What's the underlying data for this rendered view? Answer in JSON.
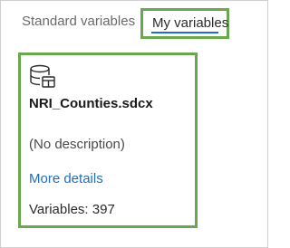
{
  "tabs": {
    "standard_label": "Standard variables",
    "my_label": "My variables"
  },
  "card": {
    "icon": "database-icon",
    "file_name": "NRI_Counties.sdcx",
    "description": "(No description)",
    "more_details_label": "More details",
    "variables_label": "Variables: 397"
  },
  "colors": {
    "highlight_border": "#6aa84f",
    "link": "#1f6fbf",
    "tab_underline": "#1f6fbf"
  }
}
